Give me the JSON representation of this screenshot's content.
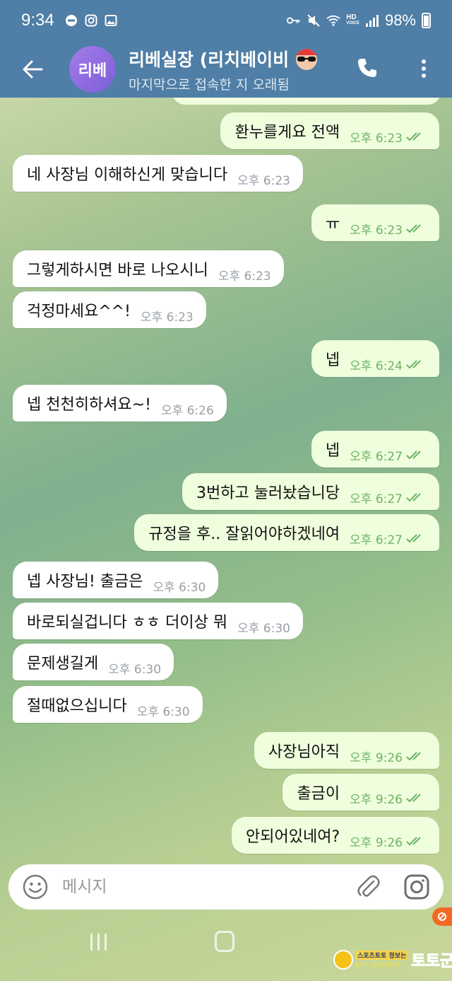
{
  "status_bar": {
    "time": "9:34",
    "battery": "98%",
    "hd_label": "HD",
    "voice_label": "VOICE",
    "left_icons": [
      "dnd-icon",
      "instagram-icon",
      "gallery-icon"
    ],
    "right_icons": [
      "key-icon",
      "mute-icon",
      "wifi-icon",
      "signal-icon",
      "battery-icon"
    ]
  },
  "header": {
    "avatar_text": "리베",
    "title": "리베실장 (리치베이비",
    "subtitle": "마지막으로 접속한 지 오래됨"
  },
  "messages": [
    {
      "dir": "out",
      "text": "환누를게요 전액",
      "time": "오후 6:23",
      "read": true
    },
    {
      "dir": "in",
      "text": "네 사장님 이해하신게 맞습니다",
      "time": "오후 6:23"
    },
    {
      "dir": "out",
      "text": "ㅠ",
      "time": "오후 6:23",
      "read": true
    },
    {
      "dir": "in",
      "text": "그렇게하시면 바로 나오시니",
      "time": "오후 6:23"
    },
    {
      "dir": "in",
      "text": "걱정마세요^^!",
      "time": "오후 6:23"
    },
    {
      "dir": "out",
      "text": "넵",
      "time": "오후 6:24",
      "read": true
    },
    {
      "dir": "in",
      "text": "넵 천천히하셔요~!",
      "time": "오후 6:26"
    },
    {
      "dir": "out",
      "text": "넵",
      "time": "오후 6:27",
      "read": true
    },
    {
      "dir": "out",
      "text": "3번하고 눌러놨습니당",
      "time": "오후 6:27",
      "read": true
    },
    {
      "dir": "out",
      "text": "규정을 후.. 잘읽어야하겠네여",
      "time": "오후 6:27",
      "read": true
    },
    {
      "dir": "in",
      "text": "넵 사장님! 출금은",
      "time": "오후 6:30"
    },
    {
      "dir": "in",
      "text": "바로되실겁니다 ㅎㅎ 더이상 뭐",
      "time": "오후 6:30"
    },
    {
      "dir": "in",
      "text": "문제생길게",
      "time": "오후 6:30"
    },
    {
      "dir": "in",
      "text": "절때없으십니다",
      "time": "오후 6:30"
    },
    {
      "dir": "out",
      "text": "사장님아직",
      "time": "오후 9:26",
      "read": true
    },
    {
      "dir": "out",
      "text": "출금이",
      "time": "오후 9:26",
      "read": true
    },
    {
      "dir": "out",
      "text": "안되어있네여?",
      "time": "오후 9:26",
      "read": true
    }
  ],
  "input": {
    "placeholder": "메시지",
    "value": ""
  },
  "watermark": {
    "line1": "스포츠토토 정보는",
    "line2": "BEST 검증커뮤니티",
    "brand": "토토군"
  },
  "colors": {
    "header": "#4f7ea6",
    "outgoing_bubble": "#effedd",
    "incoming_bubble": "#ffffff",
    "read_check": "#6db366",
    "avatar": "#8d6ce0"
  }
}
